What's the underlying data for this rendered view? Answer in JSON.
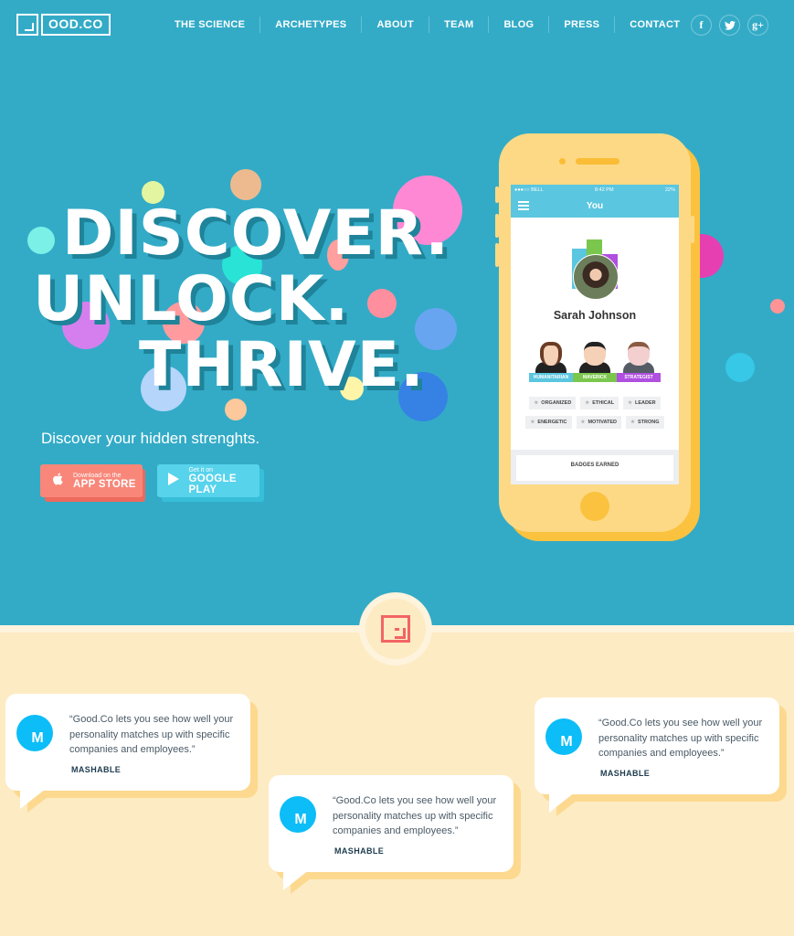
{
  "brand": {
    "logo_letter": "G",
    "logo_text": "OOD.CO"
  },
  "nav": {
    "items": [
      {
        "label": "THE SCIENCE"
      },
      {
        "label": "ARCHETYPES"
      },
      {
        "label": "ABOUT"
      },
      {
        "label": "TEAM"
      },
      {
        "label": "BLOG"
      },
      {
        "label": "PRESS"
      },
      {
        "label": "CONTACT"
      }
    ],
    "social": [
      {
        "icon": "facebook-icon",
        "glyph": "f"
      },
      {
        "icon": "twitter-icon",
        "glyph": "t"
      },
      {
        "icon": "google-plus-icon",
        "glyph": "g+"
      }
    ]
  },
  "hero": {
    "headline": [
      "DISCOVER.",
      "UNLOCK.",
      "THRIVE."
    ],
    "tagline": "Discover your hidden strenghts.",
    "app_store": {
      "sub": "Download on the",
      "main": "APP STORE",
      "icon": "apple-icon"
    },
    "google_play": {
      "sub": "Get it on",
      "main": "GOOGLE PLAY",
      "icon": "play-icon"
    }
  },
  "phone": {
    "status": {
      "carrier": "●●●○○ BELL",
      "time": "8:42 PM",
      "battery": "22%"
    },
    "app_title": "You",
    "user_name": "Sarah Johnson",
    "archetypes": [
      {
        "label": "HUMANITARIAN",
        "color": "#5bc6df"
      },
      {
        "label": "MAVERICK",
        "color": "#7bc74d"
      },
      {
        "label": "STRATEGIST",
        "color": "#b04fe0"
      }
    ],
    "traits_row1": [
      "ORGANIZED",
      "ETHICAL",
      "LEADER"
    ],
    "traits_row2": [
      "ENERGETIC",
      "MOTIVATED",
      "STRONG"
    ],
    "badges_label": "BADGES EARNED"
  },
  "testimonials": [
    {
      "initial": "M",
      "quote": "“Good.Co lets you see how well your personality matches up with specific companies and employees.”",
      "source": "MASHABLE"
    },
    {
      "initial": "M",
      "quote": "“Good.Co lets you see how well your personality matches up with specific companies and employees.”",
      "source": "MASHABLE"
    },
    {
      "initial": "M",
      "quote": "“Good.Co lets you see how well your personality matches up with specific companies and employees.”",
      "source": "MASHABLE"
    }
  ],
  "colors": {
    "hero_bg": "#33abc7",
    "lower_bg": "#fdebc4",
    "accent_red": "#f36464",
    "app_store_btn": "#f8877a",
    "google_play_btn": "#57d3ec",
    "phone_body": "#fdd985",
    "mashable_blue": "#0cbdf7"
  }
}
